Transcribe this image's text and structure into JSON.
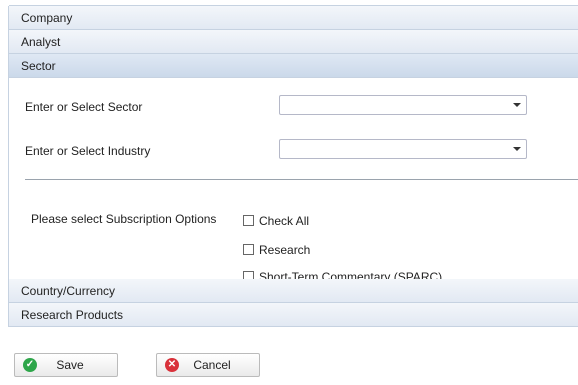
{
  "accordion": {
    "sections": [
      "Company",
      "Analyst",
      "Sector",
      "Country/Currency",
      "Research Products"
    ]
  },
  "sector": {
    "sector_label": "Enter or Select Sector",
    "sector_value": "",
    "industry_label": "Enter or Select Industry",
    "industry_value": "",
    "subscription_label": "Please select Subscription Options",
    "options": [
      "Check All",
      "Research",
      "Short-Term Commentary (SPARC)"
    ]
  },
  "buttons": {
    "save": "Save",
    "cancel": "Cancel"
  },
  "icons": {
    "save": "check-icon",
    "cancel": "x-icon"
  },
  "colors": {
    "save_icon": "#2ea64a",
    "cancel_icon": "#d9313a"
  }
}
